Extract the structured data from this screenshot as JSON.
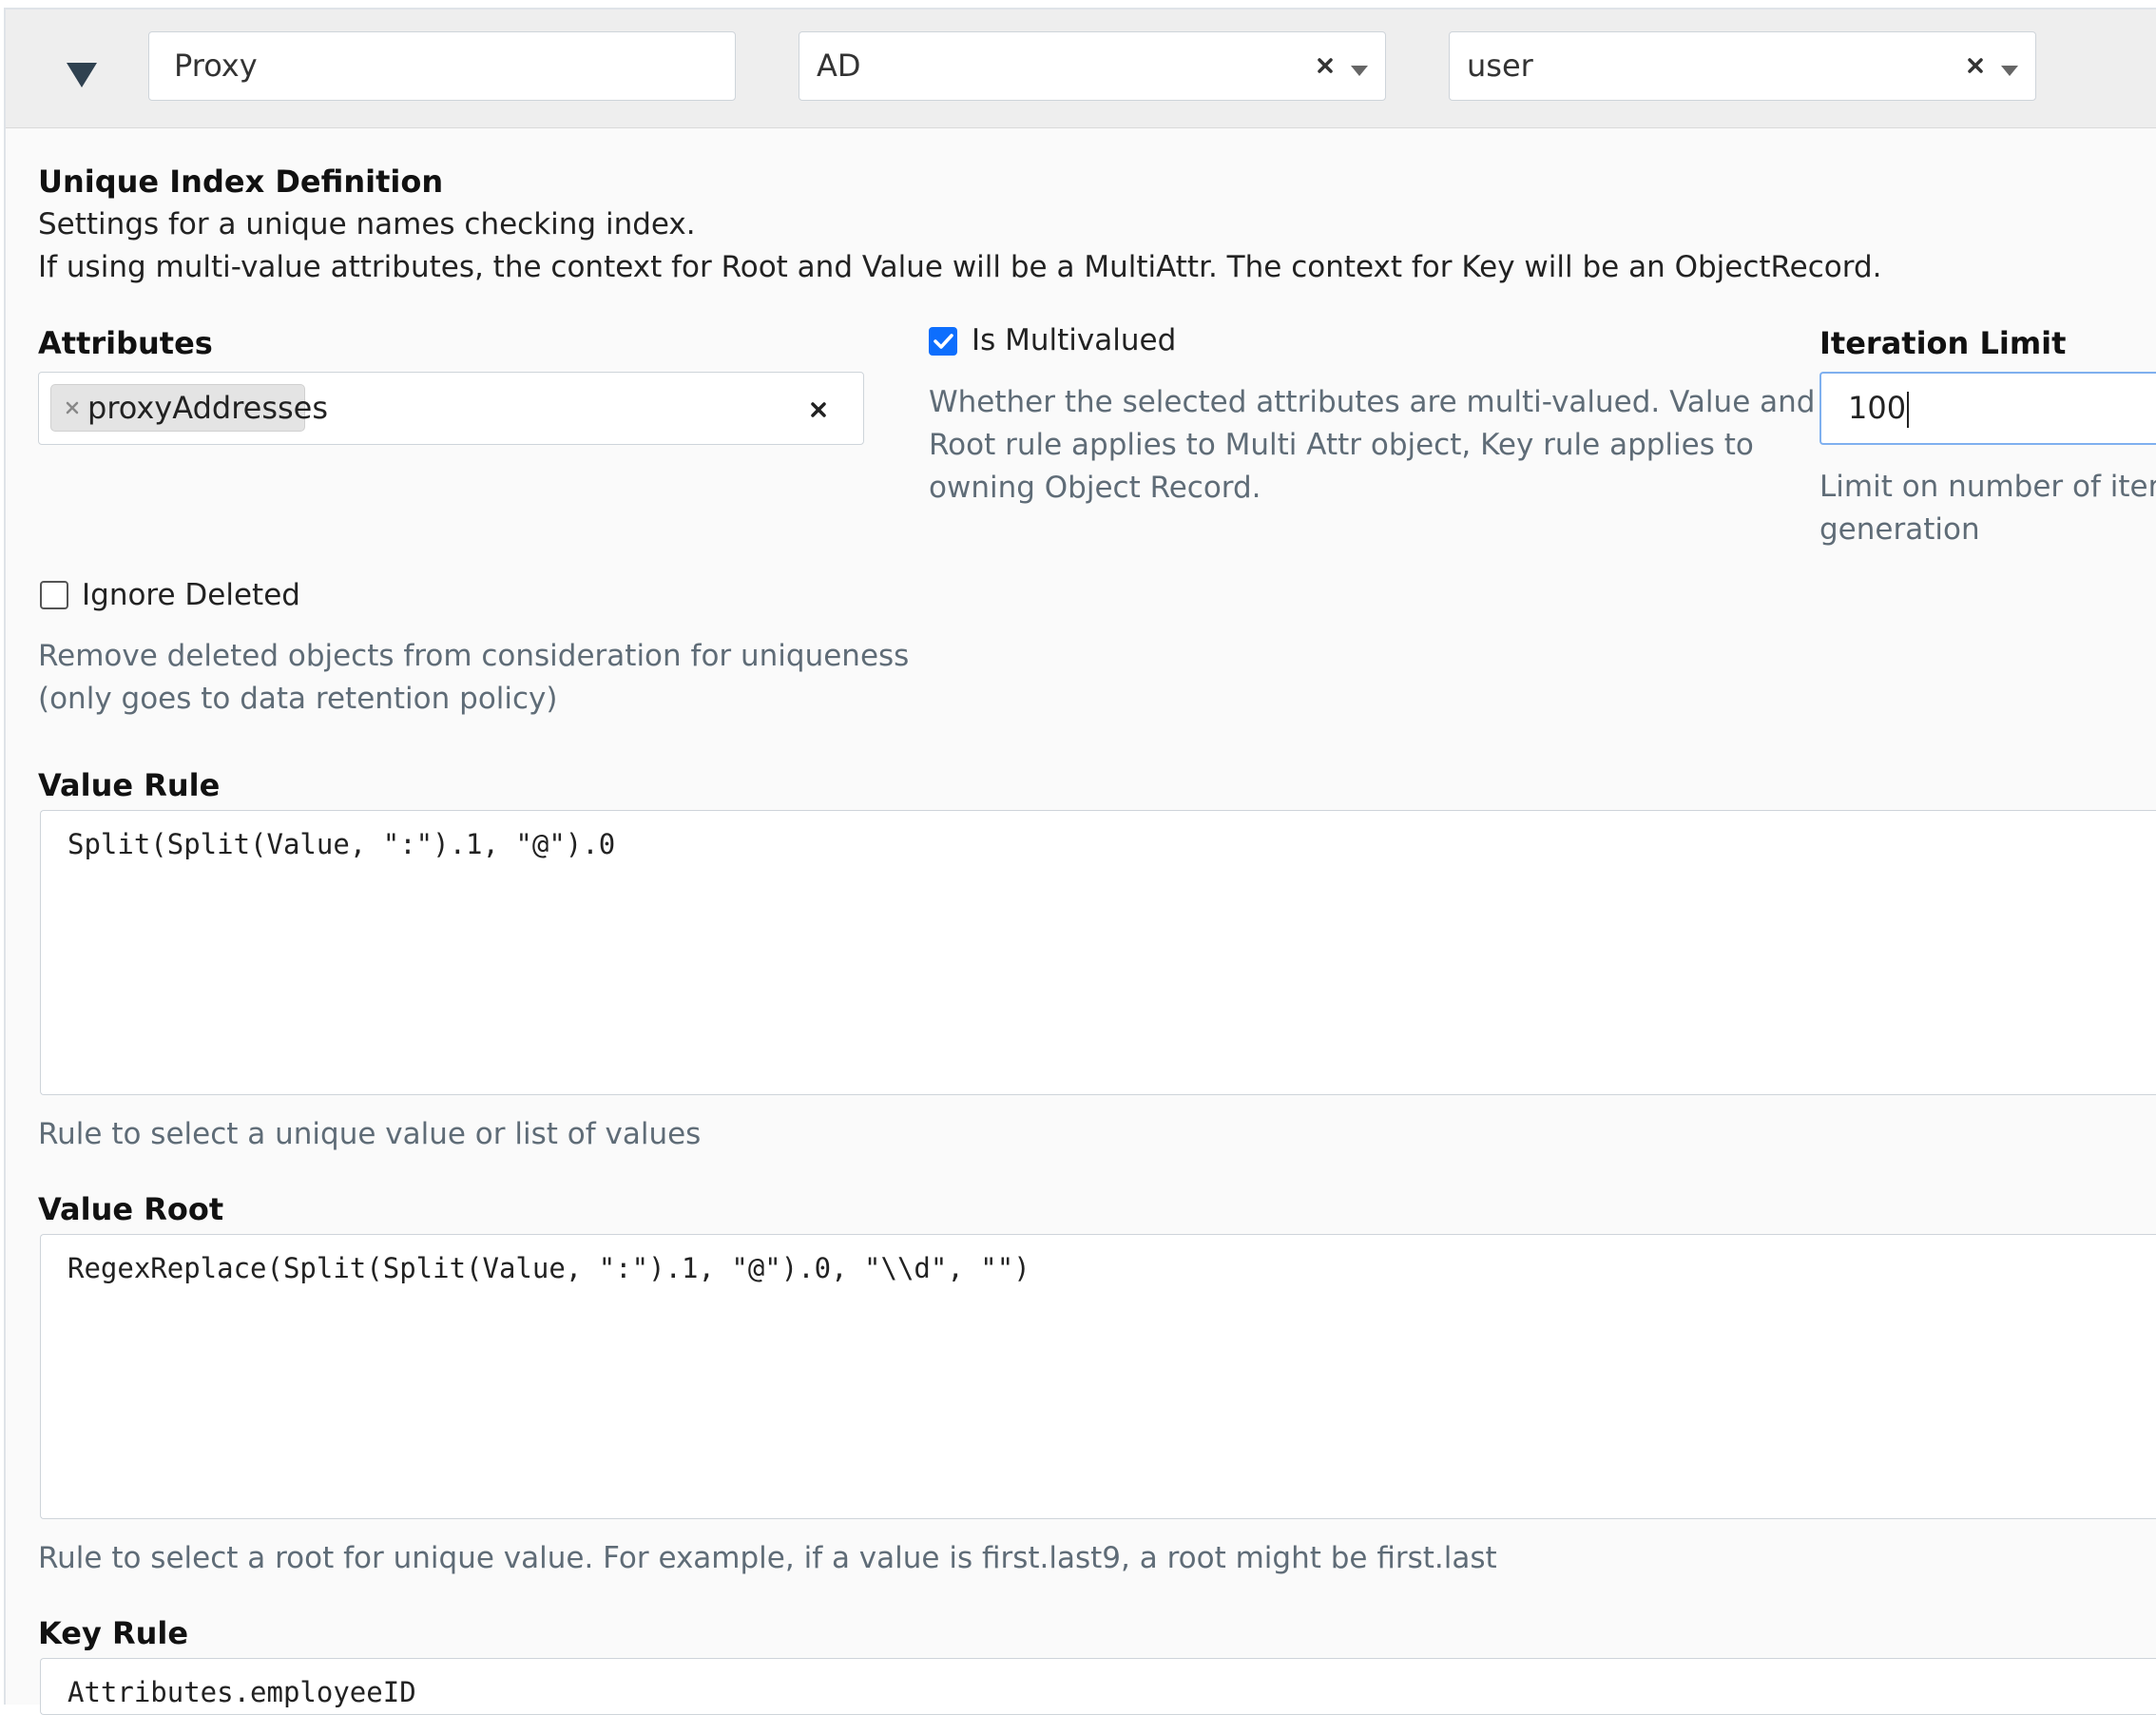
{
  "header": {
    "name_value": "Proxy",
    "source_select": {
      "value": "AD",
      "clear_icon": "x-icon",
      "arrow_icon": "caret-down-icon"
    },
    "type_select": {
      "value": "user",
      "clear_icon": "x-icon",
      "arrow_icon": "caret-down-icon"
    },
    "collapse_icon": "triangle-down-icon"
  },
  "section": {
    "title": "Unique Index Definition",
    "desc1": "Settings for a unique names checking index.",
    "desc2": "If using multi-value attributes, the context for Root and Value will be a MultiAttr. The context for Key will be an ObjectRecord."
  },
  "attributes": {
    "label": "Attributes",
    "tags": [
      "proxyAddresses"
    ]
  },
  "multivalued": {
    "label": "Is Multivalued",
    "checked": true,
    "help_lines": [
      "Whether the selected attributes are multi-valued. Value and",
      "Root rule applies to Multi Attr object, Key rule applies to",
      "owning Object Record."
    ]
  },
  "iteration": {
    "label": "Iteration Limit",
    "value": "100",
    "help_lines": [
      "Limit on number of iterati",
      "generation"
    ]
  },
  "ignore_deleted": {
    "label": "Ignore Deleted",
    "checked": false,
    "help_lines": [
      "Remove deleted objects from consideration for uniqueness",
      "(only goes to data retention policy)"
    ]
  },
  "value_rule": {
    "label": "Value Rule",
    "code": "Split(Split(Value, \":\").1, \"@\").0",
    "help": "Rule to select a unique value or list of values"
  },
  "value_root": {
    "label": "Value Root",
    "code": "RegexReplace(Split(Split(Value, \":\").1, \"@\").0, \"\\\\d\", \"\")",
    "help": "Rule to select a root for unique value. For example, if a value is first.last9, a root might be first.last"
  },
  "key_rule": {
    "label": "Key Rule",
    "code": "Attributes.employeeID"
  },
  "colors": {
    "accent": "#0d6efd",
    "help_text": "#5f6c77",
    "header_bg": "#eeeeee"
  }
}
